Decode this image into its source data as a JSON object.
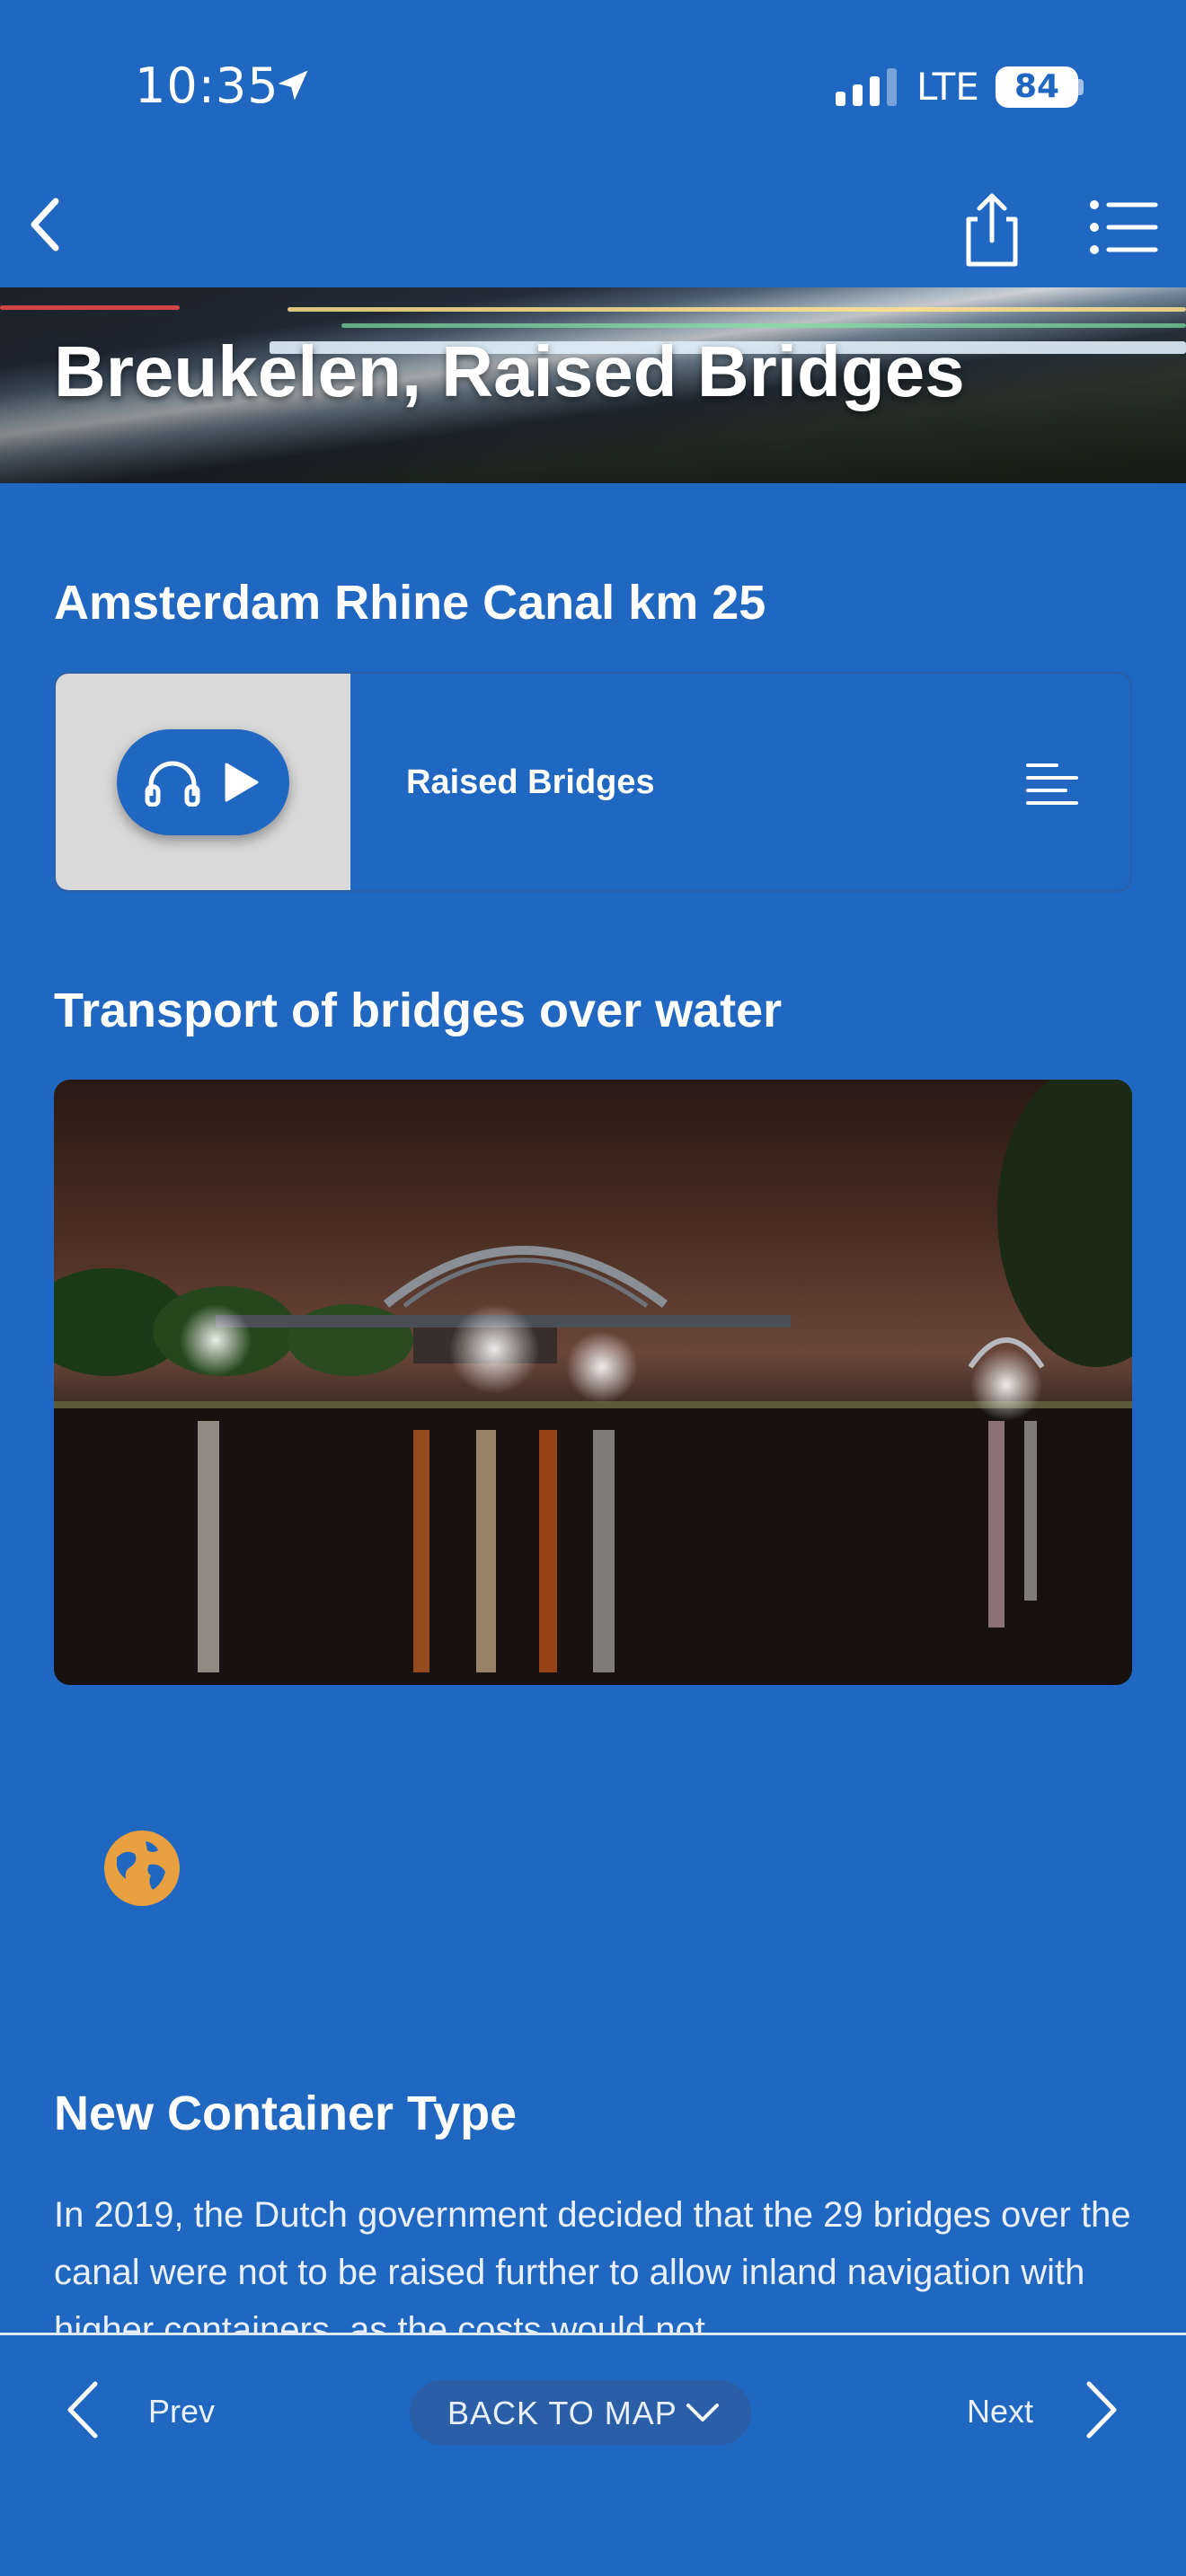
{
  "status_bar": {
    "time": "10:35",
    "network": "LTE",
    "battery": "84"
  },
  "nav": {
    "back_icon": "chevron-left-icon",
    "share_icon": "share-icon",
    "menu_icon": "list-icon"
  },
  "hero": {
    "title": "Breukelen, Raised Bridges"
  },
  "location": {
    "heading": "Amsterdam Rhine Canal km 25"
  },
  "audio": {
    "title": "Raised Bridges",
    "play_icon": "headphones-play-icon",
    "transcript_icon": "text-lines-icon"
  },
  "section_photo": {
    "heading": "Transport of bridges over water"
  },
  "globe_icon": "globe-icon",
  "section_container": {
    "heading": "New Container Type",
    "body": "In 2019, the Dutch government decided that the 29 bridges over the canal were not to be raised further to allow inland navigation with higher containers, as the costs would not"
  },
  "bottom_bar": {
    "prev": "Prev",
    "back_to_map": "BACK TO MAP",
    "next": "Next"
  },
  "colors": {
    "background": "#1f67c0",
    "globe": "#e8a040",
    "thumb": "#d9d9d9"
  }
}
